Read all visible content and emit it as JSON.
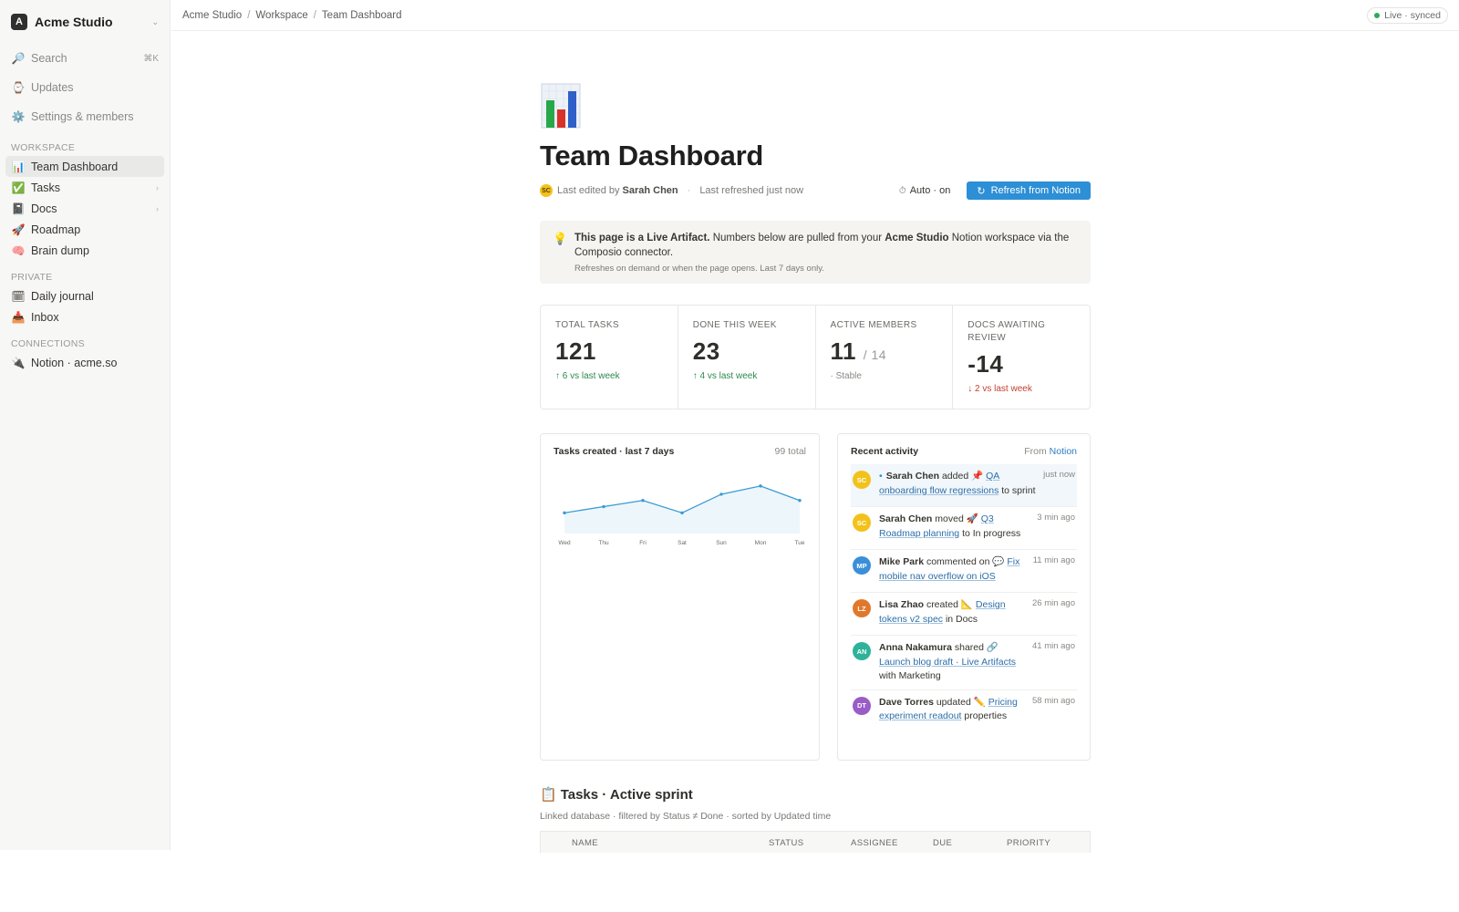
{
  "workspace": {
    "logo_letter": "A",
    "name": "Acme Studio"
  },
  "sidebar": {
    "utility": [
      {
        "label": "Search",
        "shortcut": "⌘K",
        "icon": "search-icon"
      },
      {
        "label": "Updates",
        "icon": "bell-icon"
      },
      {
        "label": "Settings & members",
        "icon": "gear-icon"
      }
    ],
    "sections": {
      "workspace": "WORKSPACE",
      "private": "PRIVATE",
      "connections": "CONNECTIONS"
    },
    "workspace_items": [
      {
        "label": "Team Dashboard",
        "emoji": "📊"
      },
      {
        "label": "Tasks",
        "emoji": "✅"
      },
      {
        "label": "Docs",
        "emoji": "📓"
      },
      {
        "label": "Roadmap",
        "emoji": "🚀"
      },
      {
        "label": "Brain dump",
        "emoji": "🧠"
      }
    ],
    "private_items": [
      {
        "label": "Daily journal",
        "emoji": "🗓"
      },
      {
        "label": "Inbox",
        "emoji": "📥"
      }
    ],
    "connection_items": [
      {
        "label": "Notion · acme.so",
        "emoji": "🔌"
      }
    ]
  },
  "topbar": {
    "breadcrumb": [
      "Acme Studio",
      "Workspace",
      "Team Dashboard"
    ],
    "status": "Live · synced"
  },
  "page": {
    "title": "Team Dashboard",
    "editor_initials": "SC",
    "last_edited_prefix": "Last edited by",
    "last_edited_by": "Sarah Chen",
    "last_refreshed": "Last refreshed just now",
    "auto_label": "Auto · on",
    "refresh_button": "Refresh from Notion"
  },
  "callout": {
    "bold_lead": "This page is a Live Artifact.",
    "text_1": "Numbers below are pulled from your",
    "workspace_bold": "Acme Studio",
    "text_2": "Notion workspace via the Composio connector.",
    "sub": "Refreshes on demand or when the page opens. Last 7 days only."
  },
  "stats": [
    {
      "label": "TOTAL TASKS",
      "value": "121",
      "suffix": "",
      "delta": "↑ 6 vs last week",
      "trend": "up"
    },
    {
      "label": "DONE THIS WEEK",
      "value": "23",
      "suffix": "",
      "delta": "↑ 4 vs last week",
      "trend": "up"
    },
    {
      "label": "ACTIVE MEMBERS",
      "value": "11",
      "suffix": "/ 14",
      "delta": "· Stable",
      "trend": "flat"
    },
    {
      "label": "DOCS AWAITING REVIEW",
      "value": "-14",
      "suffix": "",
      "delta": "↓ 2 vs last week",
      "trend": "down"
    }
  ],
  "chart_panel": {
    "title": "Tasks created · last 7 days",
    "total": "99 total"
  },
  "chart_data": {
    "type": "area",
    "categories": [
      "Wed",
      "Thu",
      "Fri",
      "Sat",
      "Sun",
      "Mon",
      "Tue"
    ],
    "values": [
      10,
      13,
      16,
      10,
      19,
      23,
      16
    ],
    "ylim": [
      0,
      30
    ],
    "grid": false,
    "color": "#3a9bd3"
  },
  "activity": {
    "title": "Recent activity",
    "source_prefix": "From",
    "source_link": "Notion",
    "items": [
      {
        "initials": "SC",
        "color": "#f2c21b",
        "bullet": "•",
        "actor": "Sarah Chen",
        "verb": "added",
        "emoji": "📌",
        "target": "QA onboarding flow regressions",
        "tail": "to sprint",
        "time": "just now"
      },
      {
        "initials": "SC",
        "color": "#f2c21b",
        "bullet": "",
        "actor": "Sarah Chen",
        "verb": "moved",
        "emoji": "🚀",
        "target": "Q3 Roadmap planning",
        "tail": "to In progress",
        "time": "3 min ago"
      },
      {
        "initials": "MP",
        "color": "#3a8fd8",
        "bullet": "",
        "actor": "Mike Park",
        "verb": "commented on",
        "emoji": "💬",
        "target": "Fix mobile nav overflow on iOS",
        "tail": "",
        "time": "11 min ago"
      },
      {
        "initials": "LZ",
        "color": "#e0782c",
        "bullet": "",
        "actor": "Lisa Zhao",
        "verb": "created",
        "emoji": "📐",
        "target": "Design tokens v2 spec",
        "tail": "in Docs",
        "time": "26 min ago"
      },
      {
        "initials": "AN",
        "color": "#2eb39a",
        "bullet": "",
        "actor": "Anna Nakamura",
        "verb": "shared",
        "emoji": "🔗",
        "target": "Launch blog draft · Live Artifacts",
        "tail": "with Marketing",
        "time": "41 min ago"
      },
      {
        "initials": "DT",
        "color": "#9a5cc6",
        "bullet": "",
        "actor": "Dave Torres",
        "verb": "updated",
        "emoji": "✏️",
        "target": "Pricing experiment readout",
        "tail": "properties",
        "time": "58 min ago"
      }
    ]
  },
  "tasks_db": {
    "emoji": "📋",
    "title": "Tasks · Active sprint",
    "subtitle": "Linked database · filtered by Status ≠ Done · sorted by Updated time",
    "columns": [
      "NAME",
      "STATUS",
      "ASSIGNEE",
      "DUE",
      "PRIORITY"
    ]
  }
}
